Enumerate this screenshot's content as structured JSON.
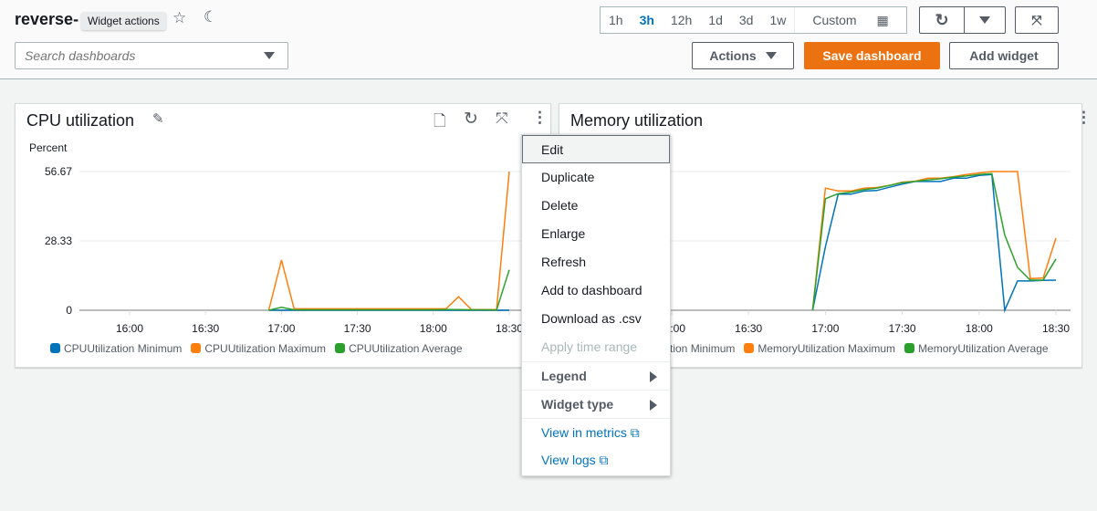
{
  "header": {
    "title": "reverse-",
    "tooltip": "Widget actions",
    "search_placeholder": "Search dashboards",
    "time_ranges": [
      "1h",
      "3h",
      "12h",
      "1d",
      "3d",
      "1w"
    ],
    "selected_range": "3h",
    "custom_label": "Custom",
    "actions_label": "Actions",
    "save_label": "Save dashboard",
    "add_widget_label": "Add widget"
  },
  "colors": {
    "minimum": "#0073bb",
    "maximum": "#ff7f0e",
    "average": "#2ca02c",
    "accent": "#ec7211"
  },
  "menu": {
    "items": [
      "Edit",
      "Duplicate",
      "Delete",
      "Enlarge",
      "Refresh",
      "Add to dashboard",
      "Download as .csv",
      "Apply time range"
    ],
    "submenus": [
      "Legend",
      "Widget type"
    ],
    "links": [
      "View in metrics",
      "View logs"
    ]
  },
  "chart_data": [
    {
      "type": "line",
      "title": "CPU utilization",
      "ylabel": "Percent",
      "ylim": [
        0,
        56.67
      ],
      "yticks": [
        "0",
        "28.33",
        "56.67"
      ],
      "xticks": [
        "16:00",
        "16:30",
        "17:00",
        "17:30",
        "18:00",
        "18:30"
      ],
      "grid": true,
      "legend": "bottom",
      "x": [
        "16:55",
        "17:00",
        "17:05",
        "17:10",
        "17:15",
        "17:20",
        "17:25",
        "17:30",
        "17:35",
        "17:40",
        "17:45",
        "17:50",
        "17:55",
        "18:00",
        "18:05",
        "18:10",
        "18:15",
        "18:20",
        "18:25",
        "18:30"
      ],
      "series": [
        {
          "name": "CPUUtilization Minimum",
          "values": [
            0,
            0,
            0,
            0,
            0,
            0,
            0,
            0,
            0,
            0,
            0,
            0,
            0,
            0,
            0,
            0,
            0,
            0,
            0,
            0
          ]
        },
        {
          "name": "CPUUtilization Maximum",
          "values": [
            0,
            20.5,
            0.6,
            0.6,
            0.6,
            0.6,
            0.6,
            0.6,
            0.6,
            0.6,
            0.6,
            0.6,
            0.6,
            0.6,
            0.6,
            5.5,
            0.3,
            0.3,
            0.3,
            56.67
          ]
        },
        {
          "name": "CPUUtilization Average",
          "values": [
            0,
            1.2,
            0.2,
            0.2,
            0.2,
            0.2,
            0.2,
            0.2,
            0.2,
            0.2,
            0.2,
            0.2,
            0.2,
            0.2,
            0.3,
            0.3,
            0.2,
            0.2,
            0.1,
            16.5
          ]
        }
      ]
    },
    {
      "type": "line",
      "title": "Memory utilization",
      "xticks": [
        "16:00",
        "16:30",
        "17:00",
        "17:30",
        "18:00",
        "18:30"
      ],
      "grid": true,
      "legend": "bottom",
      "x": [
        "16:55",
        "17:00",
        "17:05",
        "17:10",
        "17:15",
        "17:20",
        "17:25",
        "17:30",
        "17:35",
        "17:40",
        "17:45",
        "17:50",
        "17:55",
        "18:00",
        "18:05",
        "18:10",
        "18:15",
        "18:20",
        "18:25",
        "18:30"
      ],
      "series": [
        {
          "name": "MemoryUtilization Minimum",
          "values": [
            0,
            45.7,
            83.7,
            83.7,
            85.9,
            86.3,
            88.7,
            90.9,
            92.8,
            92.8,
            92.8,
            95.2,
            95.2,
            97.2,
            97.8,
            0,
            21.1,
            21.1,
            21.5,
            21.7
          ]
        },
        {
          "name": "MemoryUtilization Maximum",
          "values": [
            0,
            88,
            86,
            86,
            88,
            88.5,
            90,
            92.4,
            93,
            95.2,
            95.2,
            96.3,
            97.8,
            99,
            100,
            100,
            100,
            22.8,
            23.3,
            52
          ]
        },
        {
          "name": "MemoryUtilization Average",
          "values": [
            0,
            80.4,
            84.1,
            85.2,
            87,
            88,
            90,
            92,
            92.8,
            94,
            94.8,
            96,
            96.8,
            97.8,
            98.5,
            54.3,
            30.9,
            21.7,
            21.7,
            37
          ]
        }
      ]
    }
  ]
}
